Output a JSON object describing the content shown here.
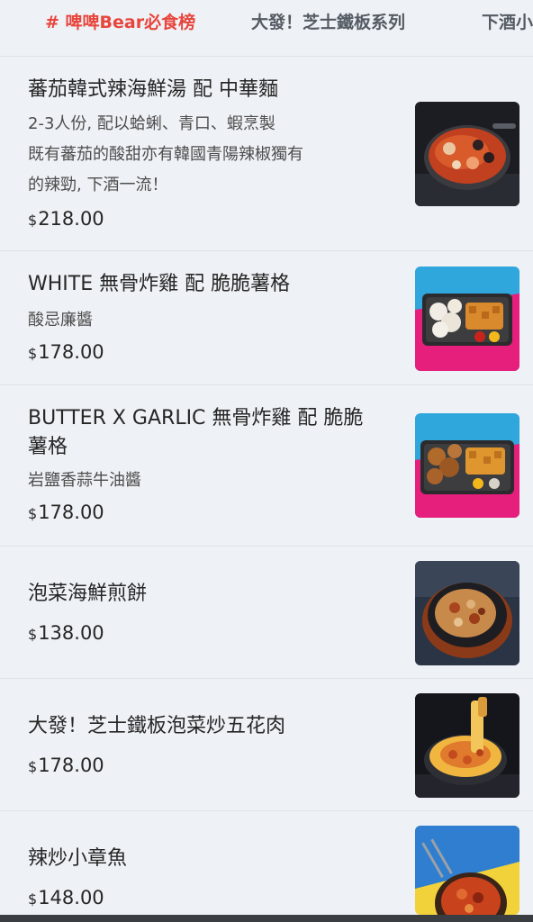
{
  "tabs": [
    {
      "label": "# 啤啤Bear必食榜",
      "active": true
    },
    {
      "label": "大發！芝士鐵板系列",
      "active": false
    },
    {
      "label": "下酒小",
      "active": false
    }
  ],
  "items": [
    {
      "name": "蕃茄韓式辣海鮮湯 配 中華麵",
      "desc_lines": [
        "2-3人份, 配以蛤蜊、青口、蝦烹製",
        "既有蕃茄的酸甜亦有韓國青陽辣椒獨有",
        "的辣勁, 下酒一流！"
      ],
      "currency": "$",
      "price": "218.00",
      "image": "tomato-seafood-stew-photo"
    },
    {
      "name": "WHITE 無骨炸雞 配 脆脆薯格",
      "desc_lines": [
        "酸忌廉醬"
      ],
      "currency": "$",
      "price": "178.00",
      "image": "white-fried-chicken-photo"
    },
    {
      "name": "BUTTER X GARLIC 無骨炸雞 配 脆脆薯格",
      "desc_lines": [
        "岩鹽香蒜牛油醬"
      ],
      "currency": "$",
      "price": "178.00",
      "image": "butter-garlic-fried-chicken-photo"
    },
    {
      "name": "泡菜海鮮煎餅",
      "desc_lines": [],
      "currency": "$",
      "price": "138.00",
      "image": "kimchi-seafood-pancake-photo"
    },
    {
      "name": "大發！芝士鐵板泡菜炒五花肉",
      "desc_lines": [],
      "currency": "$",
      "price": "178.00",
      "image": "cheese-kimchi-pork-photo"
    },
    {
      "name": "辣炒小章魚",
      "desc_lines": [],
      "currency": "$",
      "price": "148.00",
      "image": "spicy-baby-octopus-photo"
    }
  ],
  "colors": {
    "accent": "#e8453c",
    "background": "#eef1f5",
    "divider": "#dfe3e8"
  }
}
